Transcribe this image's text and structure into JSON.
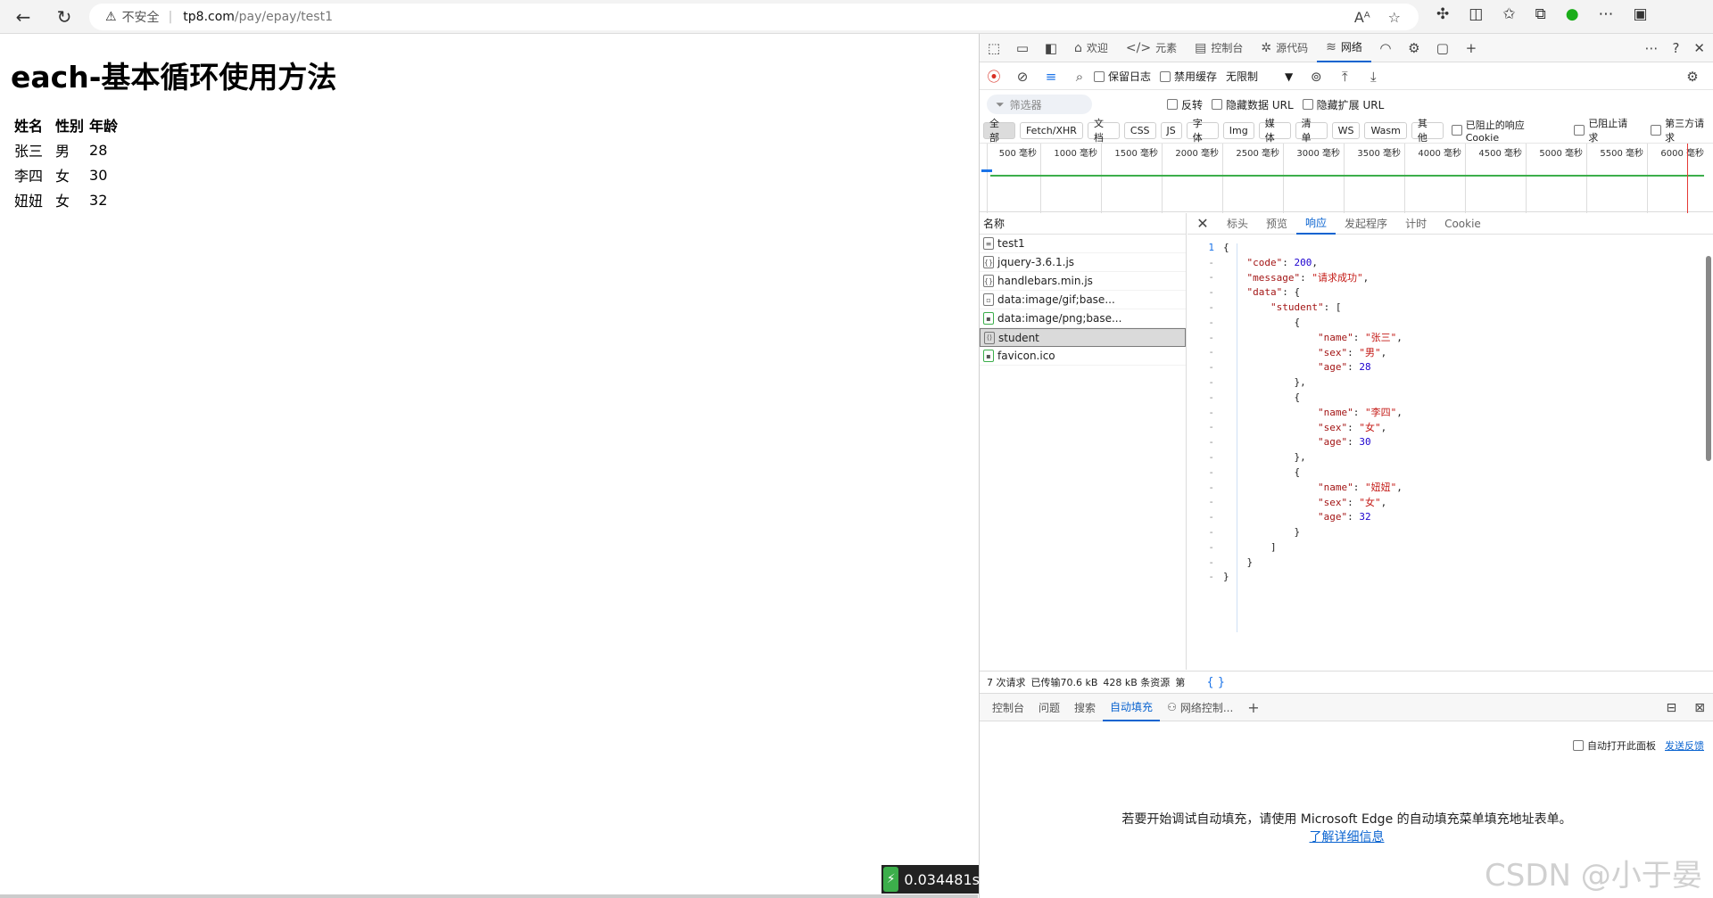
{
  "browser": {
    "security_label": "不安全",
    "url_host": "tp8.com",
    "url_path": "/pay/epay/test1"
  },
  "page": {
    "heading": "each-基本循环使用方法",
    "table": {
      "headers": [
        "姓名",
        "性别",
        "年龄"
      ],
      "rows": [
        [
          "张三",
          "男",
          "28"
        ],
        [
          "李四",
          "女",
          "30"
        ],
        [
          "妞妞",
          "女",
          "32"
        ]
      ]
    },
    "timer": "0.034481s"
  },
  "devtools": {
    "tabs": [
      {
        "label": "欢迎",
        "icon": "home-icon"
      },
      {
        "label": "元素",
        "icon": "code-icon"
      },
      {
        "label": "控制台",
        "icon": "console-icon"
      },
      {
        "label": "源代码",
        "icon": "bug-icon"
      },
      {
        "label": "网络",
        "icon": "wifi-icon",
        "active": true
      }
    ],
    "toolbar": {
      "preserve_log": "保留日志",
      "disable_cache": "禁用缓存",
      "throttle": "无限制"
    },
    "filter": {
      "placeholder": "筛选器",
      "invert": "反转",
      "hide_data_urls": "隐藏数据 URL",
      "hide_extension_urls": "隐藏扩展 URL"
    },
    "type_filters": [
      "全部",
      "Fetch/XHR",
      "文档",
      "CSS",
      "JS",
      "字体",
      "Img",
      "媒体",
      "清单",
      "WS",
      "Wasm",
      "其他"
    ],
    "extra_filters": [
      "已阻止的响应 Cookie",
      "已阻止请求",
      "第三方请求"
    ],
    "timeline_ticks": [
      "500 毫秒",
      "1000 毫秒",
      "1500 毫秒",
      "2000 毫秒",
      "2500 毫秒",
      "3000 毫秒",
      "3500 毫秒",
      "4000 毫秒",
      "4500 毫秒",
      "5000 毫秒",
      "5500 毫秒",
      "6000 毫秒"
    ],
    "names_header": "名称",
    "requests": [
      {
        "name": "test1",
        "icon": "document-icon"
      },
      {
        "name": "jquery-3.6.1.js",
        "icon": "script-icon"
      },
      {
        "name": "handlebars.min.js",
        "icon": "script-icon"
      },
      {
        "name": "data:image/gif;base...",
        "icon": "image-icon"
      },
      {
        "name": "data:image/png;base...",
        "icon": "image-icon"
      },
      {
        "name": "student",
        "icon": "fetch-icon",
        "selected": true
      },
      {
        "name": "favicon.ico",
        "icon": "image-icon"
      }
    ],
    "detail_tabs": [
      "标头",
      "预览",
      "响应",
      "发起程序",
      "计时",
      "Cookie"
    ],
    "detail_active": "响应",
    "response_lines": [
      {
        "ln": "1",
        "text": "{"
      },
      {
        "ln": "-",
        "text": "    \"code\": 200,"
      },
      {
        "ln": "-",
        "text": "    \"message\": \"请求成功\","
      },
      {
        "ln": "-",
        "text": "    \"data\": {"
      },
      {
        "ln": "-",
        "text": "        \"student\": ["
      },
      {
        "ln": "-",
        "text": "            {"
      },
      {
        "ln": "-",
        "text": "                \"name\": \"张三\","
      },
      {
        "ln": "-",
        "text": "                \"sex\": \"男\","
      },
      {
        "ln": "-",
        "text": "                \"age\": 28"
      },
      {
        "ln": "-",
        "text": "            },"
      },
      {
        "ln": "-",
        "text": "            {"
      },
      {
        "ln": "-",
        "text": "                \"name\": \"李四\","
      },
      {
        "ln": "-",
        "text": "                \"sex\": \"女\","
      },
      {
        "ln": "-",
        "text": "                \"age\": 30"
      },
      {
        "ln": "-",
        "text": "            },"
      },
      {
        "ln": "-",
        "text": "            {"
      },
      {
        "ln": "-",
        "text": "                \"name\": \"妞妞\","
      },
      {
        "ln": "-",
        "text": "                \"sex\": \"女\","
      },
      {
        "ln": "-",
        "text": "                \"age\": 32"
      },
      {
        "ln": "-",
        "text": "            }"
      },
      {
        "ln": "-",
        "text": "        ]"
      },
      {
        "ln": "-",
        "text": "    }"
      },
      {
        "ln": "-",
        "text": "}"
      }
    ],
    "summary": {
      "requests": "7 次请求",
      "transferred": "已传输70.6 kB",
      "resources": "428 kB 条资源",
      "truncated": "第",
      "braces": "{ }"
    },
    "drawer_tabs": [
      "控制台",
      "问题",
      "搜索",
      "自动填充",
      "网络控制..."
    ],
    "drawer_active": "自动填充",
    "autofill": {
      "auto_open": "自动打开此面板",
      "feedback": "发送反馈",
      "message": "若要开始调试自动填充，请使用 Microsoft Edge 的自动填充菜单填充地址表单。",
      "learn_more": "了解详细信息"
    }
  },
  "watermark": "CSDN @小于晏",
  "colors": {
    "accent": "#0b64d0",
    "record_red": "#d93025",
    "timeline_green": "#3cae4b"
  }
}
